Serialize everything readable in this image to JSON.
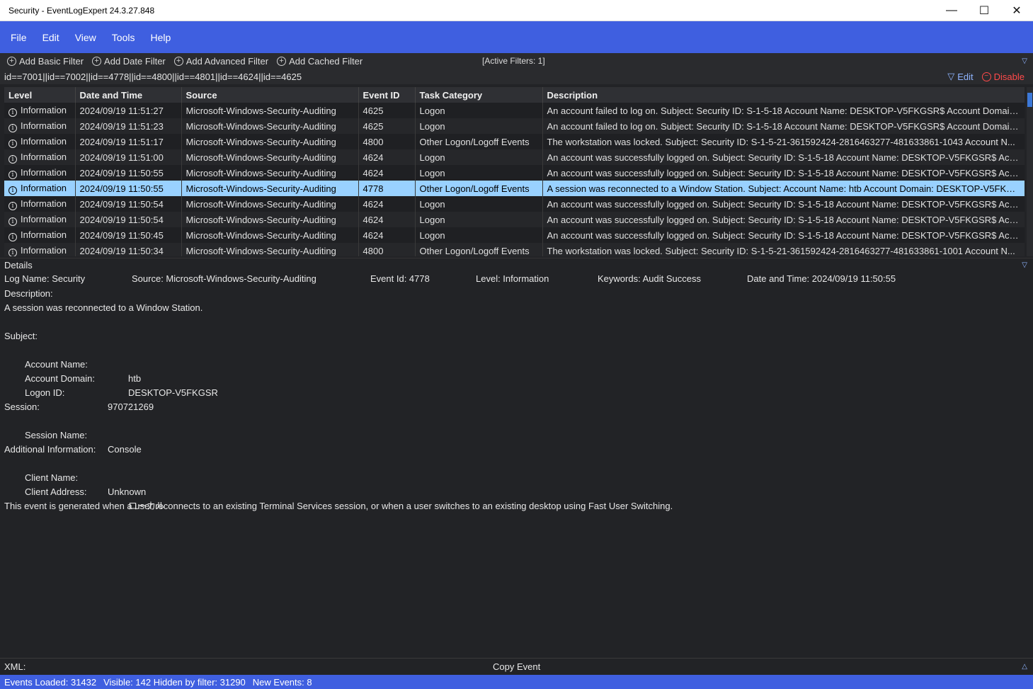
{
  "window": {
    "title": "Security - EventLogExpert 24.3.27.848",
    "minimize": "—",
    "maximize": "☐",
    "close": "✕"
  },
  "menu": [
    "File",
    "Edit",
    "View",
    "Tools",
    "Help"
  ],
  "filters": {
    "add_basic": "Add Basic Filter",
    "add_date": "Add Date Filter",
    "add_advanced": "Add Advanced Filter",
    "add_cached": "Add Cached Filter",
    "active": "[Active Filters: 1]",
    "expression": "id==7001||id==7002||id==4778||id==4800||id==4801||id==4624||id==4625",
    "edit_label": "Edit",
    "disable_label": "Disable"
  },
  "grid": {
    "columns": [
      "Level",
      "Date and Time",
      "Source",
      "Event ID",
      "Task Category",
      "Description"
    ],
    "rows": [
      {
        "level": "Information",
        "date": "2024/09/19 11:51:27",
        "source": "Microsoft-Windows-Security-Auditing",
        "id": "4625",
        "task": "Logon",
        "desc": "An account failed to log on. Subject: Security ID: S-1-5-18 Account Name: DESKTOP-V5FKGSR$ Account Domain:..."
      },
      {
        "level": "Information",
        "date": "2024/09/19 11:51:23",
        "source": "Microsoft-Windows-Security-Auditing",
        "id": "4625",
        "task": "Logon",
        "desc": "An account failed to log on. Subject: Security ID: S-1-5-18 Account Name: DESKTOP-V5FKGSR$ Account Domain:..."
      },
      {
        "level": "Information",
        "date": "2024/09/19 11:51:17",
        "source": "Microsoft-Windows-Security-Auditing",
        "id": "4800",
        "task": "Other Logon/Logoff Events",
        "desc": "The workstation was locked. Subject: Security ID: S-1-5-21-361592424-2816463277-481633861-1043 Account N..."
      },
      {
        "level": "Information",
        "date": "2024/09/19 11:51:00",
        "source": "Microsoft-Windows-Security-Auditing",
        "id": "4624",
        "task": "Logon",
        "desc": "An account was successfully logged on. Subject: Security ID: S-1-5-18 Account Name: DESKTOP-V5FKGSR$ Acco..."
      },
      {
        "level": "Information",
        "date": "2024/09/19 11:50:55",
        "source": "Microsoft-Windows-Security-Auditing",
        "id": "4624",
        "task": "Logon",
        "desc": "An account was successfully logged on. Subject: Security ID: S-1-5-18 Account Name: DESKTOP-V5FKGSR$ Acco..."
      },
      {
        "level": "Information",
        "date": "2024/09/19 11:50:55",
        "source": "Microsoft-Windows-Security-Auditing",
        "id": "4778",
        "task": "Other Logon/Logoff Events",
        "desc": "A session was reconnected to a Window Station. Subject: Account Name: htb Account Domain: DESKTOP-V5FKG...",
        "selected": true
      },
      {
        "level": "Information",
        "date": "2024/09/19 11:50:54",
        "source": "Microsoft-Windows-Security-Auditing",
        "id": "4624",
        "task": "Logon",
        "desc": "An account was successfully logged on. Subject: Security ID: S-1-5-18 Account Name: DESKTOP-V5FKGSR$ Acco..."
      },
      {
        "level": "Information",
        "date": "2024/09/19 11:50:54",
        "source": "Microsoft-Windows-Security-Auditing",
        "id": "4624",
        "task": "Logon",
        "desc": "An account was successfully logged on. Subject: Security ID: S-1-5-18 Account Name: DESKTOP-V5FKGSR$ Acco..."
      },
      {
        "level": "Information",
        "date": "2024/09/19 11:50:45",
        "source": "Microsoft-Windows-Security-Auditing",
        "id": "4624",
        "task": "Logon",
        "desc": "An account was successfully logged on. Subject: Security ID: S-1-5-18 Account Name: DESKTOP-V5FKGSR$ Acco..."
      },
      {
        "level": "Information",
        "date": "2024/09/19 11:50:34",
        "source": "Microsoft-Windows-Security-Auditing",
        "id": "4800",
        "task": "Other Logon/Logoff Events",
        "desc": "The workstation was locked. Subject: Security ID: S-1-5-21-361592424-2816463277-481633861-1001 Account N..."
      }
    ]
  },
  "details": {
    "header": "Details",
    "log_name": "Log Name: Security",
    "source": "Source: Microsoft-Windows-Security-Auditing",
    "event_id": "Event Id: 4778",
    "level": "Level: Information",
    "keywords": "Keywords: Audit Success",
    "date_time": "Date and Time: 2024/09/19 11:50:55",
    "description_label": "Description:",
    "description": "A session was reconnected to a Window Station.",
    "subject_label": "Subject:",
    "account_name_key": "Account Name:",
    "account_name_val": "htb",
    "account_domain_key": "Account Domain:",
    "account_domain_val": "DESKTOP-V5FKGSR",
    "logon_id_key": "Logon ID:",
    "logon_id_val": "970721269",
    "session_label": "Session:",
    "session_name_key": "Session Name:",
    "session_name_val": "Console",
    "additional_label": "Additional Information:",
    "client_name_key": "Client Name:",
    "client_name_val": "Unknown",
    "client_address_key": "Client Address:",
    "client_address_val": "ローカル",
    "footer": "This event is generated when a user reconnects to an existing Terminal Services session, or when a user switches to an existing desktop using Fast User Switching."
  },
  "xml": {
    "label": "XML:",
    "copy": "Copy Event"
  },
  "status": {
    "loaded": "Events Loaded: 31432",
    "visible": "Visible: 142 Hidden by filter: 31290",
    "new_events": "New Events: 8"
  },
  "colors": {
    "accent": "#3f5fe0",
    "selected_row": "#99d1ff",
    "disable": "#ff4a4a",
    "edit": "#8fb4ff"
  }
}
